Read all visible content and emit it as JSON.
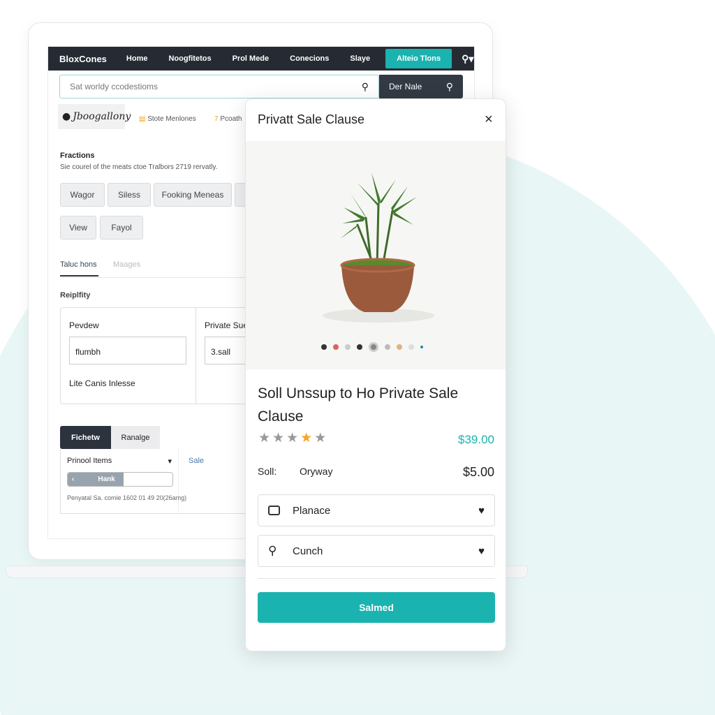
{
  "nav": {
    "brand": "BloxCones",
    "items": [
      "Home",
      "Noogfitetos",
      "Prol Mede",
      "Conecions",
      "Slaye"
    ],
    "cta": "Alteio Tlons"
  },
  "search": {
    "placeholder": "Sat worldy ccodestioms",
    "button": "Der Nale"
  },
  "logo": "Jboogallony",
  "links": [
    "Stote Menlones",
    "Pcoath"
  ],
  "section": {
    "title": "Fractions",
    "desc": "Sie courel of the meats ctoe Tralbors 2719 rervatly."
  },
  "chips": [
    "Wagor",
    "Siless",
    "Fooking Meneas",
    "View",
    "Fayol"
  ],
  "tabs": [
    "Taluc hons",
    "Maages"
  ],
  "group": {
    "title": "Reiplfity",
    "col1_label": "Pevdew",
    "col1_value": "flumbh",
    "col1_note": "Lite Canis Inlesse",
    "col2_label": "Private Sue",
    "col2_value": "3.sall"
  },
  "toggle": [
    "Fichetw",
    "Ranalge"
  ],
  "select": {
    "value": "Prinool Items",
    "link": "Sale",
    "slider_label": "Hank",
    "footer": "Penyatal Sa. comie 1602 01 49 20(26amg)"
  },
  "modal": {
    "title": "Privatt Sale Clause",
    "product_title": "Soll Unssup to Ho Private Sale Clause",
    "rating": 4,
    "rating_max": 5,
    "price": "$39.00",
    "sold_label": "Soll:",
    "sold_value": "Oryway",
    "sold_price": "$5.00",
    "options": [
      {
        "label": "Planace",
        "icon": "list-icon"
      },
      {
        "label": "Cunch",
        "icon": "location-pin-icon"
      }
    ],
    "button": "Salmed",
    "carousel_active": 4,
    "carousel_count": 9
  },
  "colors": {
    "accent": "#1ab3b0",
    "nav": "#262b33",
    "star": "#f5a623"
  }
}
